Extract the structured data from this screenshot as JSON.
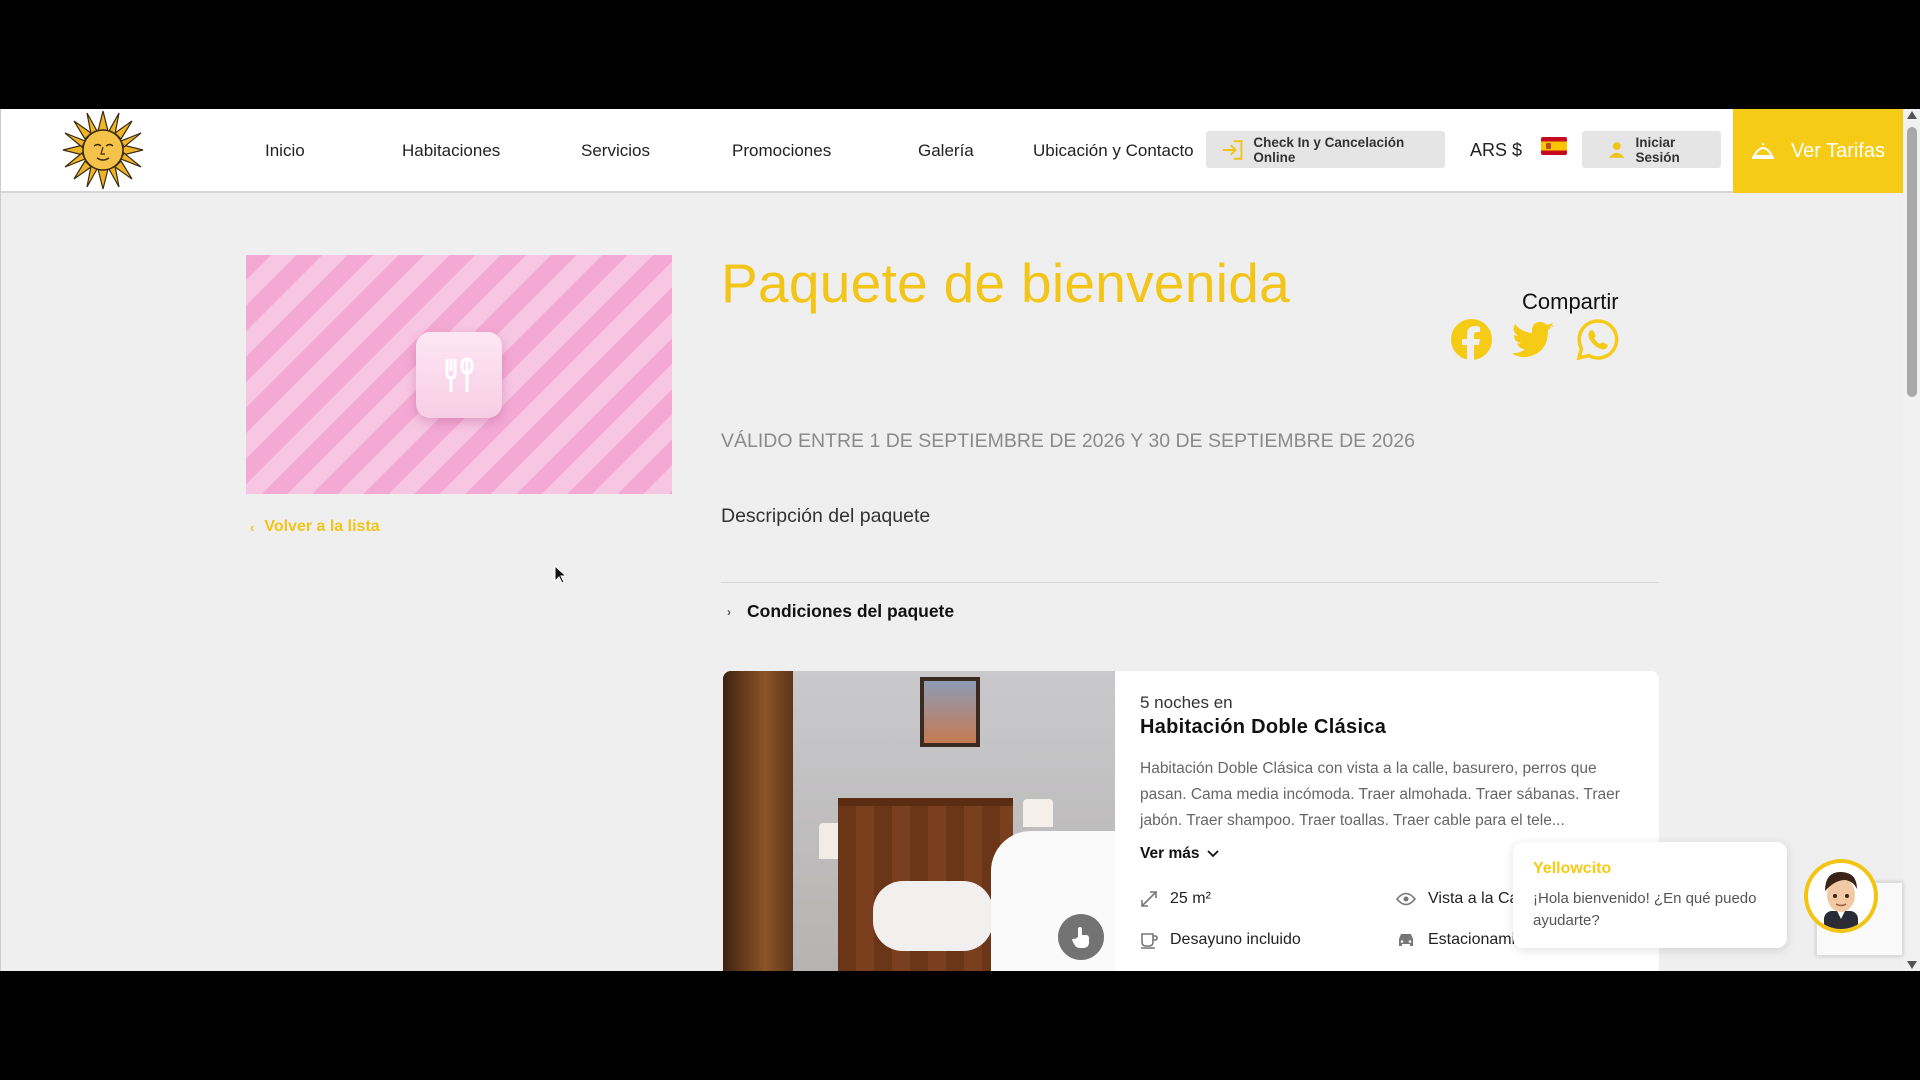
{
  "header": {
    "nav": [
      "Inicio",
      "Habitaciones",
      "Servicios",
      "Promociones",
      "Galería",
      "Ubicación y Contacto"
    ],
    "checkin_label": "Check In y Cancelación Online",
    "currency": "ARS $",
    "login_label": "Iniciar Sesión",
    "cta_label": "Ver Tarifas"
  },
  "package": {
    "title": "Paquete de bienvenida",
    "share_label": "Compartir",
    "valid_text": "VÁLIDO ENTRE 1 DE SEPTIEMBRE DE 2026 Y 30 DE SEPTIEMBRE DE 2026",
    "description": "Descripción del paquete",
    "conditions_label": "Condiciones del paquete",
    "back_label": "Volver a la lista"
  },
  "room": {
    "nights": "5 noches en",
    "title": "Habitación Doble Clásica",
    "description": "Habitación Doble Clásica con vista a la calle, basurero, perros que pasan. Cama media incómoda. Traer almohada. Traer sábanas. Traer jabón. Traer shampoo. Traer toallas. Traer cable para el tele...",
    "more_label": "Ver más",
    "features": [
      "25 m²",
      "Vista a la Ca",
      "Desayuno incluido",
      "Estacionami"
    ]
  },
  "chat": {
    "name": "Yellowcito",
    "message": "¡Hola bienvenido! ¿En qué puedo ayudarte?"
  },
  "colors": {
    "accent": "#f5cb16",
    "page_bg": "#efefef"
  }
}
